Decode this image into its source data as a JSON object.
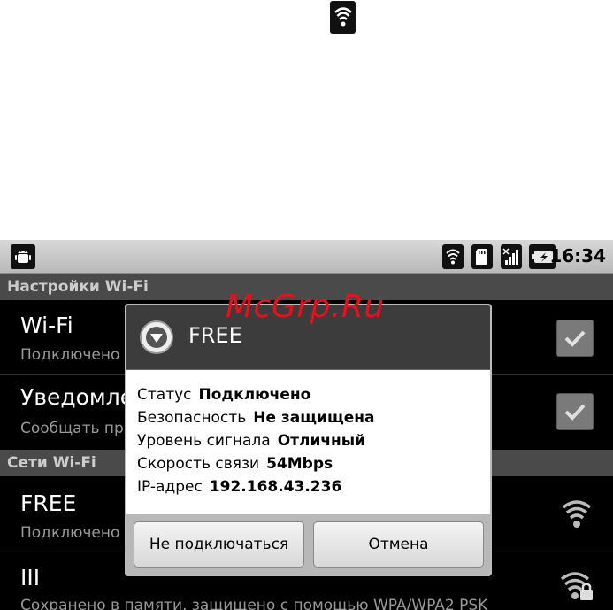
{
  "status_bar": {
    "time": "16:34",
    "icons": [
      "android-icon",
      "wifi-icon",
      "sd-card-icon",
      "signal-icon",
      "battery-icon"
    ]
  },
  "wifi_settings": {
    "header": "Настройки Wi-Fi",
    "wifi_row": {
      "title": "Wi-Fi",
      "subtitle": "Подключено к",
      "checked": true
    },
    "notify_row": {
      "title": "Уведомле",
      "subtitle": "Сообщать при",
      "checked": true
    }
  },
  "networks": {
    "header": "Сети Wi-Fi",
    "items": [
      {
        "title": "FREE",
        "subtitle": "Подключено",
        "icon": "wifi-icon"
      },
      {
        "title": "III",
        "subtitle": "Сохранено в памяти, защищено с помощью WPA/WPA2 PSK",
        "icon": "wifi-lock-icon"
      }
    ]
  },
  "dialog": {
    "title": "FREE",
    "icon": "wifi-dialog-icon",
    "info": [
      {
        "label": "Статус",
        "value": "Подключено"
      },
      {
        "label": "Безопасность",
        "value": "Не защищена"
      },
      {
        "label": "Уровень сигнала",
        "value": "Отличный"
      },
      {
        "label": "Скорость связи",
        "value": "54Mbps"
      },
      {
        "label": "IP-адрес",
        "value": "192.168.43.236"
      }
    ],
    "buttons": {
      "disconnect": "Не подключаться",
      "cancel": "Отмена"
    }
  },
  "watermark": "McGrp.Ru",
  "colors": {
    "accent_red": "#e8101a",
    "dialog_title_bg": "#3c3c3c",
    "header_bg": "#4a4a4a"
  }
}
